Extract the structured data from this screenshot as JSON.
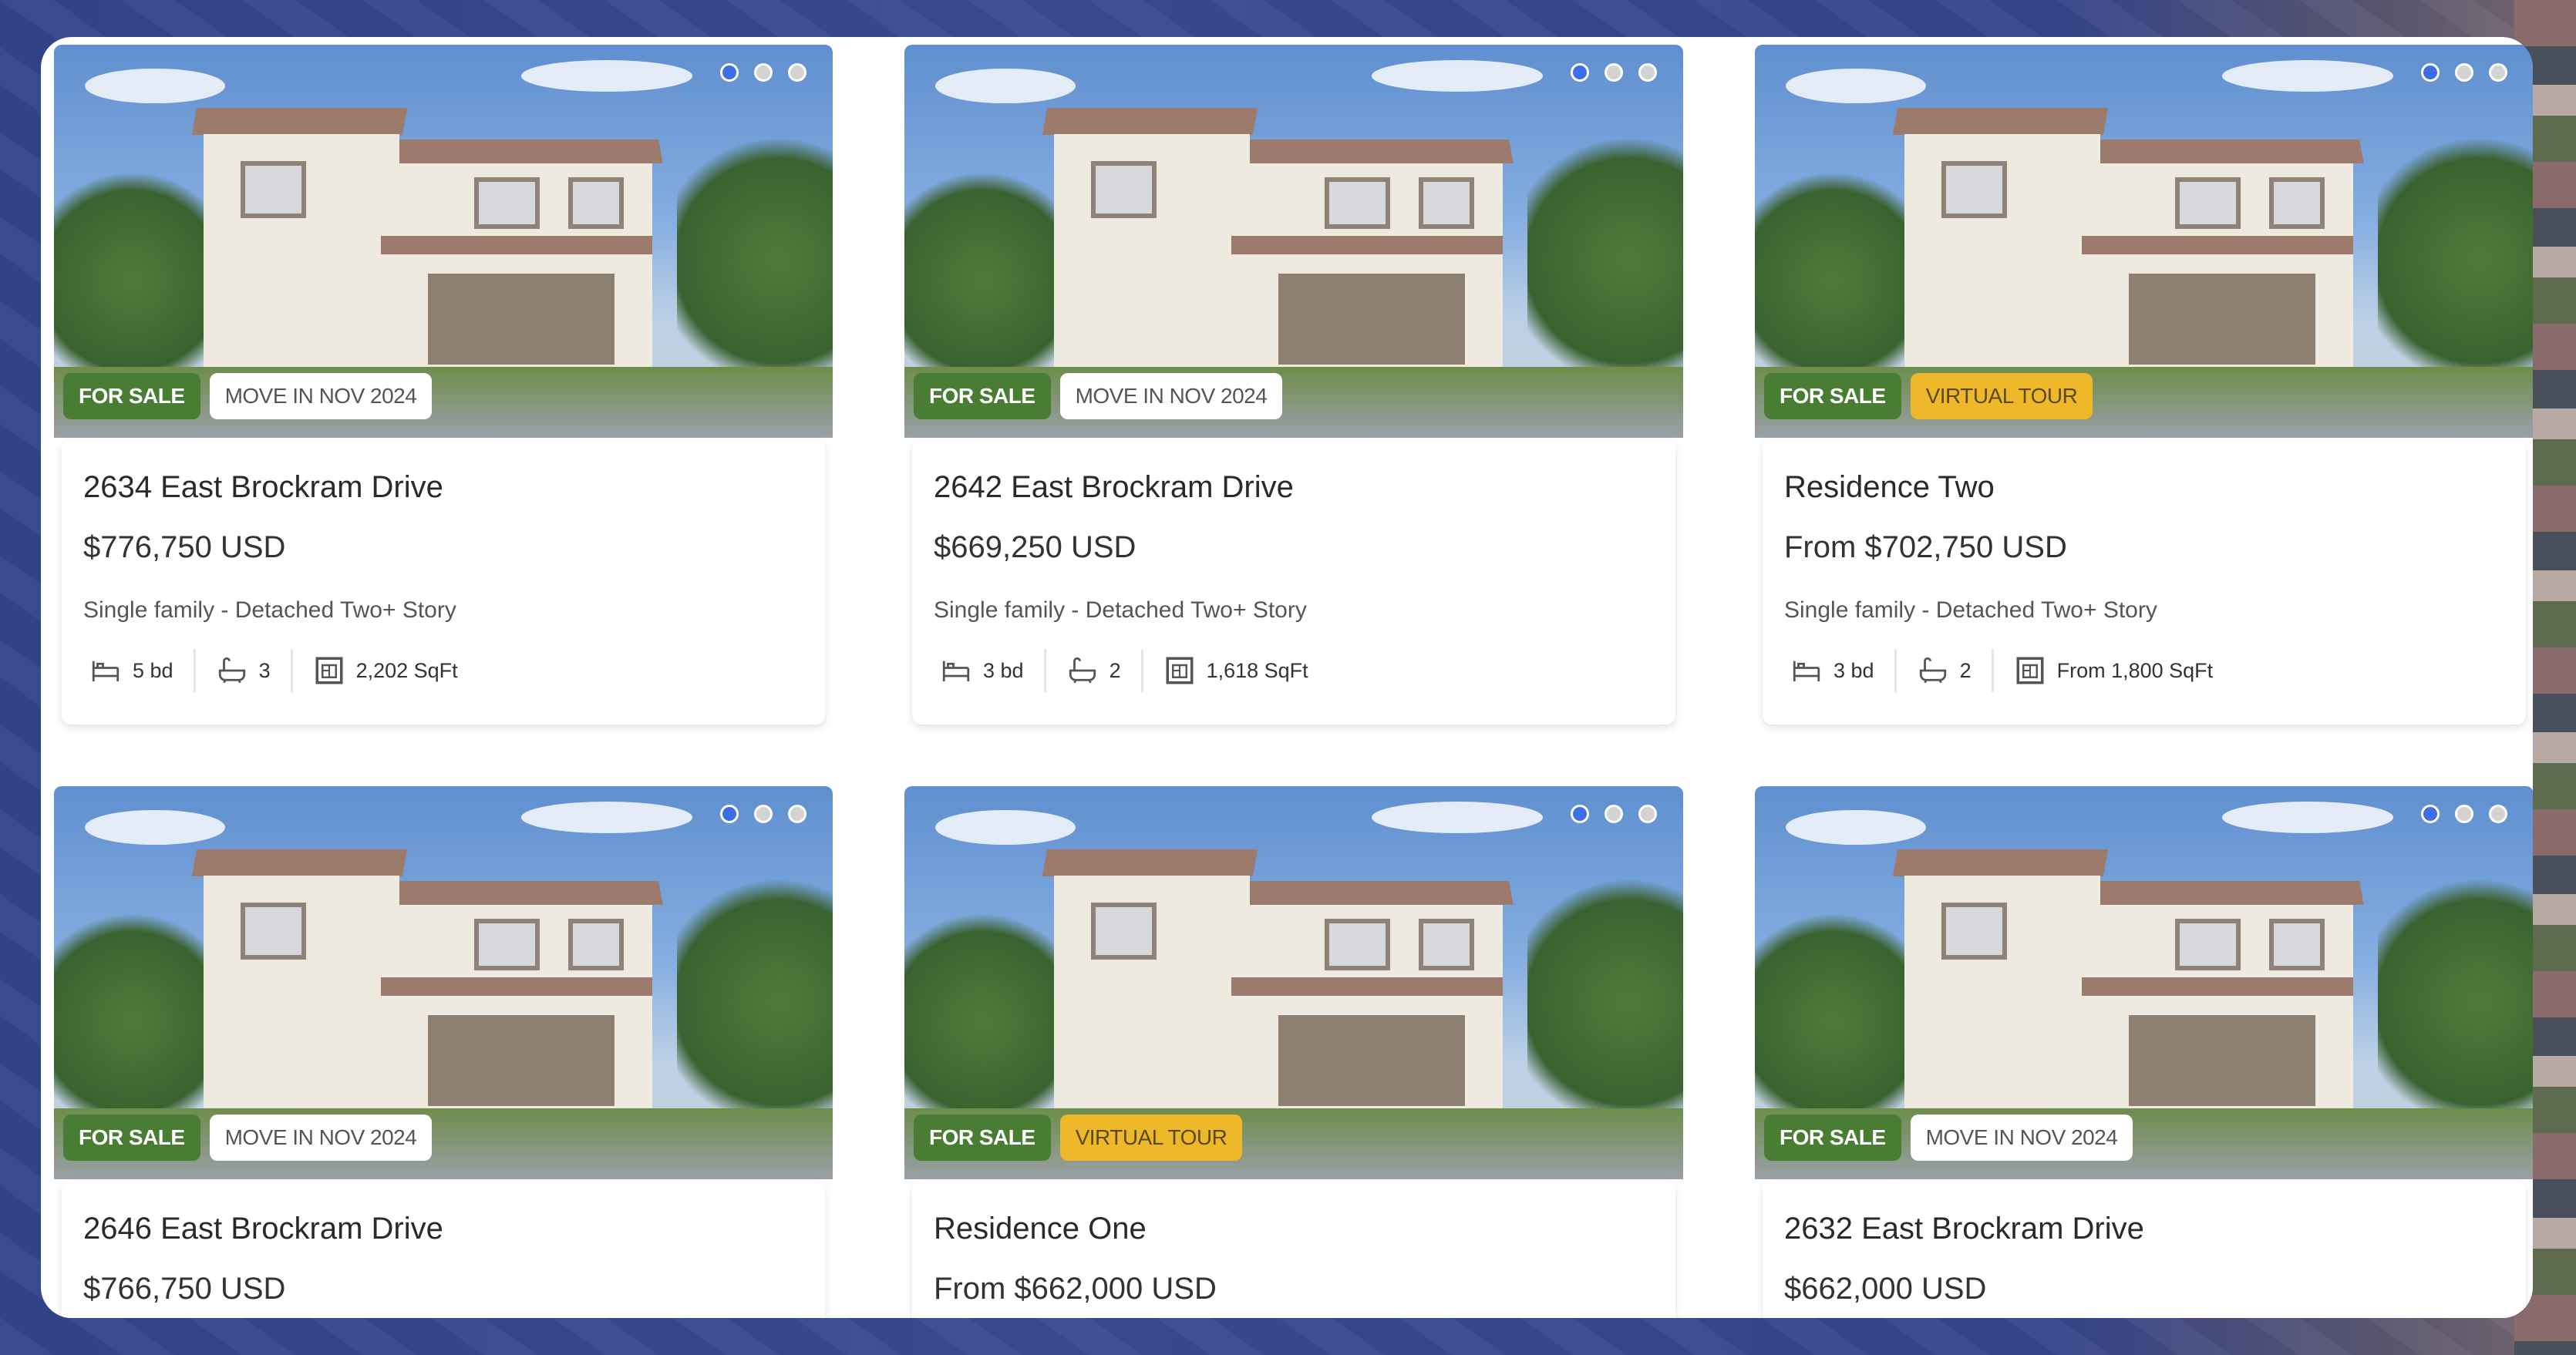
{
  "listings": [
    {
      "title": "2634 East Brockram Drive",
      "price": "$776,750 USD",
      "type": "Single family - Detached Two+ Story",
      "beds": "5 bd",
      "baths": "3",
      "sqft": "2,202 SqFt",
      "badge_status": "FOR SALE",
      "badge_extra": "MOVE IN NOV 2024",
      "badge_extra_kind": "move",
      "carousel": {
        "count": 3,
        "active": 1
      }
    },
    {
      "title": "2642 East Brockram Drive",
      "price": "$669,250 USD",
      "type": "Single family - Detached Two+ Story",
      "beds": "3 bd",
      "baths": "2",
      "sqft": "1,618 SqFt",
      "badge_status": "FOR SALE",
      "badge_extra": "MOVE IN NOV 2024",
      "badge_extra_kind": "move",
      "carousel": {
        "count": 3,
        "active": 1
      }
    },
    {
      "title": "Residence Two",
      "price": "From $702,750 USD",
      "type": "Single family - Detached Two+ Story",
      "beds": "3 bd",
      "baths": "2",
      "sqft": "From 1,800 SqFt",
      "badge_status": "FOR SALE",
      "badge_extra": "VIRTUAL TOUR",
      "badge_extra_kind": "tour",
      "carousel": {
        "count": 3,
        "active": 1
      }
    },
    {
      "title": "2646 East Brockram Drive",
      "price": "$766,750 USD",
      "badge_status": "FOR SALE",
      "badge_extra": "MOVE IN NOV 2024",
      "badge_extra_kind": "move",
      "carousel": {
        "count": 3,
        "active": 1
      }
    },
    {
      "title": "Residence One",
      "price": "From $662,000 USD",
      "badge_status": "FOR SALE",
      "badge_extra": "VIRTUAL TOUR",
      "badge_extra_kind": "tour",
      "carousel": {
        "count": 3,
        "active": 1
      }
    },
    {
      "title": "2632 East Brockram Drive",
      "price": "$662,000 USD",
      "badge_status": "FOR SALE",
      "badge_extra": "MOVE IN NOV 2024",
      "badge_extra_kind": "move",
      "carousel": {
        "count": 3,
        "active": 1
      }
    }
  ],
  "icons": {
    "beds": "bed-icon",
    "baths": "bathtub-icon",
    "sqft": "floorplan-icon"
  },
  "colors": {
    "for_sale": "#4a7d34",
    "virtual_tour": "#efb82a",
    "dot_active": "#3b6ee8",
    "dot_inactive": "#d3d3d3",
    "background": "#3a4a92"
  }
}
